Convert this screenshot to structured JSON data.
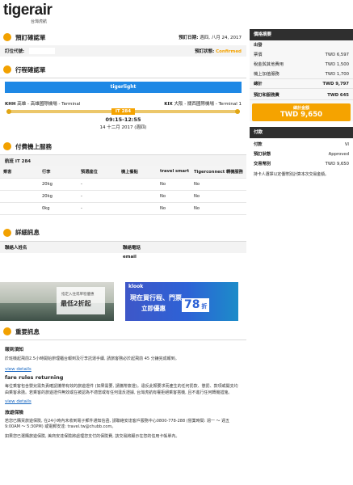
{
  "logo": {
    "brand": "tigerair",
    "sub": "台灣虎航"
  },
  "booking": {
    "title": "預訂確認單",
    "date_label": "預訂日期:",
    "date_value": "週四, 八月 24, 2017",
    "code_label": "訂位代號:",
    "code_value": "",
    "status_label": "預訂狀態:",
    "status_value": "Confirmed"
  },
  "itinerary": {
    "title": "行程確認單",
    "banner": "tigerlight",
    "from_code": "KHH",
    "from_name": "高雄 - 高雄國際機場 - Terminal",
    "to_code": "KIX",
    "to_name": "大阪 - 關西國際機場 - Terminal 1",
    "flight": "IT 284",
    "time": "09:15-12:55",
    "date": "14 十二月 2017 (週四)"
  },
  "services": {
    "title": "付費機上服務",
    "flight_label": "航班 IT 284",
    "columns": [
      "乘客",
      "行李",
      "預選座位",
      "機上餐點",
      "travel smart",
      "Tigerconnect 轉機服務"
    ],
    "rows": [
      [
        "",
        "20kg",
        "-",
        "",
        "No",
        "No"
      ],
      [
        "",
        "20kg",
        "-",
        "",
        "No",
        "No"
      ],
      [
        "",
        "0kg",
        "-",
        "",
        "No",
        "No"
      ]
    ]
  },
  "contact": {
    "title": "詳細訊息",
    "name_label": "聯絡人姓名",
    "phone_label": "聯絡電話",
    "email_label": "email"
  },
  "ads": {
    "left_line1": "指定入住或單程優惠",
    "left_line2": "最低2折起",
    "right_brand": "klook",
    "right_line1": "現在買行程、門票",
    "right_line2": "立即優惠",
    "right_num": "78",
    "right_tail": "折"
  },
  "notice": {
    "title": "重要訊息",
    "checkin_title": "報到須知",
    "checkin_text": "於班機起飛前2.5小時開始辦理櫃台報到及行李託運手續, 請旅客務必於起飛前 45 分鐘完成報到。",
    "view1": "view details",
    "fare_title": "fare rules returning",
    "fare_text": "每位乘客包含嬰兒需負責確認攜帶有效的旅遊證件 (如果需要, 請攜帶簽證)。違反此類要求而產生的任何罰款、懲罰、款項或開支均由乘客承擔。若乘客的旅遊證件無效或在被認為不適當或有任何違反證據, 台灣虎航有權拒絕乘客搭機, 且不進行任何轉機措施。",
    "view2": "view details",
    "insurance_title": "旅遊保險",
    "insurance_text1": "若您已購買旅遊保險, 在24小時內未收到電子郵件通知信函, 請聯絡安達客戶服務中心0800-778-288 (營業時間: 週一 ～ 週五 9:00AM ～ 5:30PM) 或電郵安達: travel.tw@chubb.com。",
    "insurance_text2": "如果您已選購旅遊保險, 美商安達保險將處理您支付的保險費, 該交易將顯示在您的信用卡帳單內。"
  },
  "summary": {
    "head": "價格摘要",
    "section": "出發",
    "lines": [
      {
        "label": "票價",
        "value": "TWD 6,597"
      },
      {
        "label": "稅金與其他費用",
        "value": "TWD 1,500"
      },
      {
        "label": "機上加值服務",
        "value": "TWD 1,700"
      }
    ],
    "subtotal_label": "總計",
    "subtotal_value": "TWD 9,797",
    "fee_label": "預訂和服務費",
    "fee_value": "TWD 645",
    "total_label": "總計金額",
    "total_value": "TWD 9,650"
  },
  "payment": {
    "head": "付款",
    "method_label": "付款",
    "method_value": "VI",
    "status_label": "預訂狀態",
    "status_value": "Approved",
    "amount_label": "交易幣別",
    "amount_value": "TWD 9,650",
    "note": "持卡人選擇以定價幣別計算本次交易金額。"
  },
  "colors": {
    "accent": "#f5a300",
    "blue": "#1e88e5",
    "dark": "#2f2f2f"
  }
}
